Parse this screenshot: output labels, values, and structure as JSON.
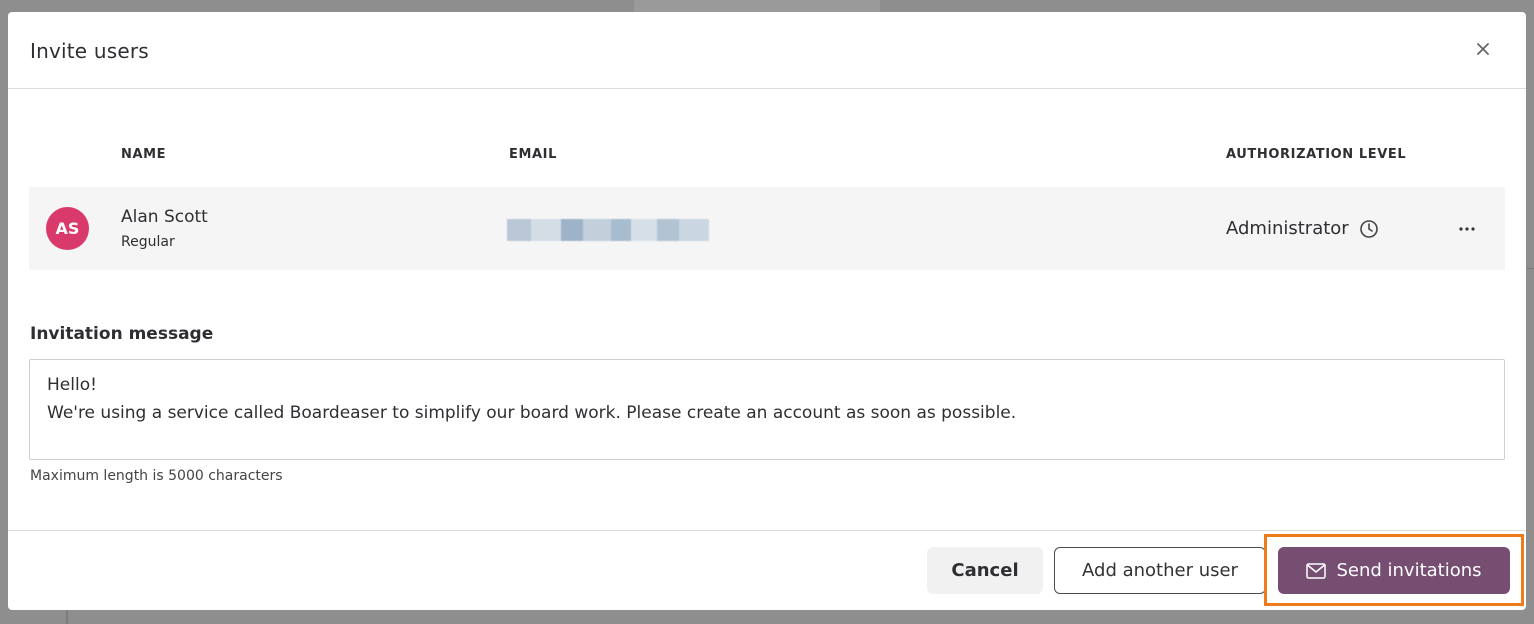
{
  "modal": {
    "title": "Invite users",
    "close_icon": "close-icon"
  },
  "table": {
    "headers": [
      "NAME",
      "EMAIL",
      "AUTHORIZATION LEVEL"
    ],
    "users": [
      {
        "initials": "AS",
        "name": "Alan Scott",
        "role": "Regular",
        "email_redacted": true,
        "authorization_level": "Administrator",
        "avatar_color": "#d93a6a"
      }
    ]
  },
  "invitation": {
    "label": "Invitation message",
    "lines": [
      "Hello!",
      "We're using a service called Boardeaser to simplify our board work. Please create an account as soon as possible."
    ],
    "hint": "Maximum length is 5000 characters"
  },
  "footer": {
    "cancel_label": "Cancel",
    "add_label": "Add another user",
    "send_label": "Send invitations",
    "send_color": "#754e72",
    "highlight_color": "#ef7b1a"
  }
}
